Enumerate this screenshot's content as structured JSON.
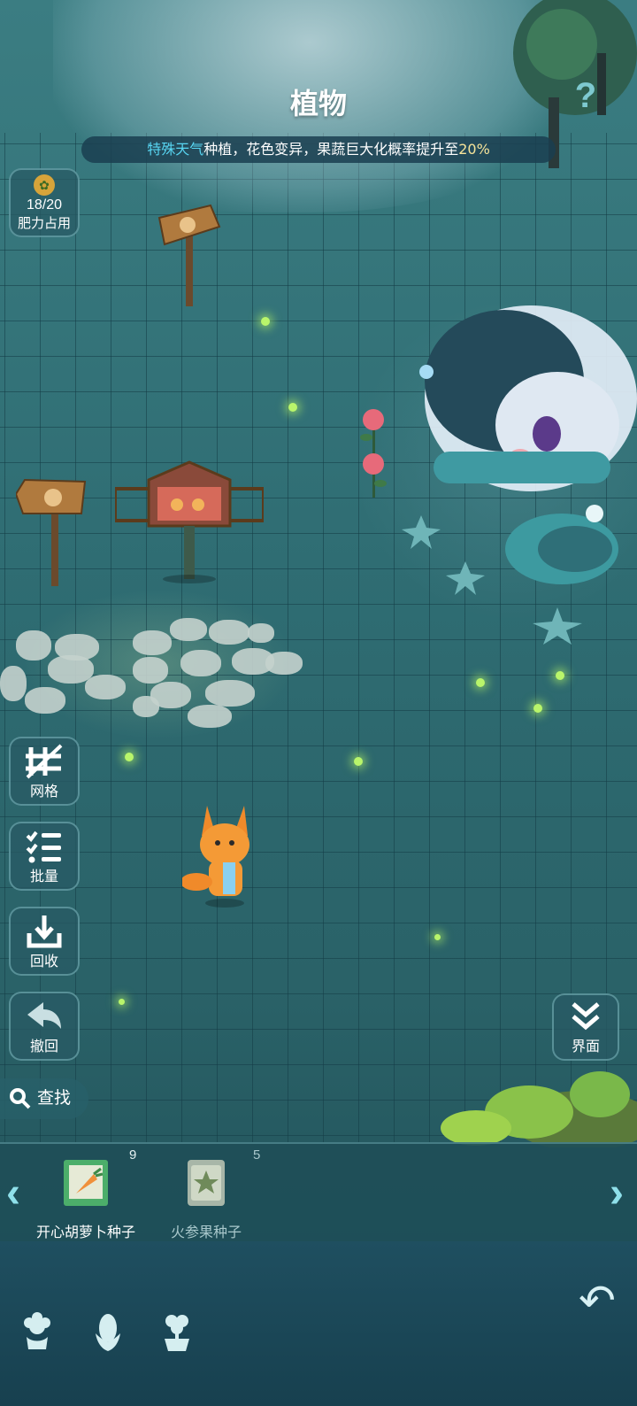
{
  "header": {
    "title": "植物",
    "banner_highlight": "特殊天气",
    "banner_text": "种植，花色变异，果蔬巨大化概率提升至",
    "banner_value": "20%"
  },
  "fertility": {
    "count": "18/20",
    "label": "肥力占用"
  },
  "side_buttons": [
    {
      "label": "网格",
      "icon": "grid-icon"
    },
    {
      "label": "批量",
      "icon": "batch-list-icon"
    },
    {
      "label": "回收",
      "icon": "recycle-icon"
    },
    {
      "label": "撤回",
      "icon": "undo-icon"
    }
  ],
  "search": {
    "label": "查找"
  },
  "view_toggle": {
    "label": "界面"
  },
  "seeds": [
    {
      "name": "开心胡萝卜种子",
      "count": "9",
      "icon": "carrot-seed-pack-icon"
    },
    {
      "name": "火参果种子",
      "count": "5",
      "icon": "pepino-seed-pack-icon"
    }
  ],
  "bottom_tabs": [
    {
      "icon": "flower-icon"
    },
    {
      "icon": "corn-icon"
    },
    {
      "icon": "plant-pot-icon"
    }
  ],
  "colors": {
    "highlight_blue": "#58d6f2",
    "highlight_yellow": "#f6e49a",
    "button_bg": "#285a64",
    "accent_cyan": "#8fe0ea"
  }
}
